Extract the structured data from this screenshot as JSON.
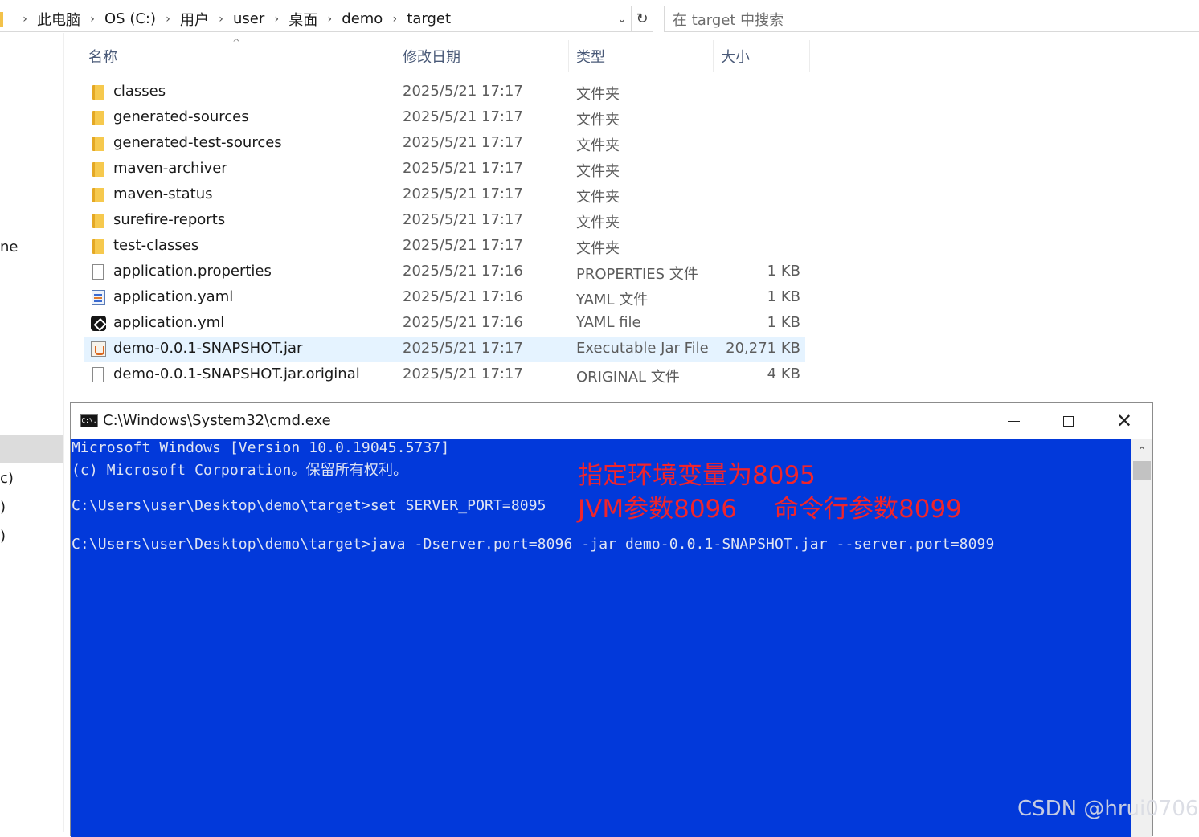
{
  "breadcrumb": [
    "此电脑",
    "OS (C:)",
    "用户",
    "user",
    "桌面",
    "demo",
    "target"
  ],
  "search": {
    "placeholder": "在 target 中搜索"
  },
  "nav_pane": {
    "fragments": [
      "ne",
      "c)",
      ")",
      ")"
    ]
  },
  "columns": {
    "name": "名称",
    "modified": "修改日期",
    "type": "类型",
    "size": "大小"
  },
  "files": [
    {
      "name": "classes",
      "modified": "2025/5/21 17:17",
      "type": "文件夹",
      "size": "",
      "icon": "folder-icon"
    },
    {
      "name": "generated-sources",
      "modified": "2025/5/21 17:17",
      "type": "文件夹",
      "size": "",
      "icon": "folder-icon"
    },
    {
      "name": "generated-test-sources",
      "modified": "2025/5/21 17:17",
      "type": "文件夹",
      "size": "",
      "icon": "folder-icon"
    },
    {
      "name": "maven-archiver",
      "modified": "2025/5/21 17:17",
      "type": "文件夹",
      "size": "",
      "icon": "folder-icon"
    },
    {
      "name": "maven-status",
      "modified": "2025/5/21 17:17",
      "type": "文件夹",
      "size": "",
      "icon": "folder-icon"
    },
    {
      "name": "surefire-reports",
      "modified": "2025/5/21 17:17",
      "type": "文件夹",
      "size": "",
      "icon": "folder-icon"
    },
    {
      "name": "test-classes",
      "modified": "2025/5/21 17:17",
      "type": "文件夹",
      "size": "",
      "icon": "folder-icon"
    },
    {
      "name": "application.properties",
      "modified": "2025/5/21 17:16",
      "type": "PROPERTIES 文件",
      "size": "1 KB",
      "icon": "document-icon"
    },
    {
      "name": "application.yaml",
      "modified": "2025/5/21 17:16",
      "type": "YAML 文件",
      "size": "1 KB",
      "icon": "yaml-file-icon"
    },
    {
      "name": "application.yml",
      "modified": "2025/5/21 17:16",
      "type": "YAML file",
      "size": "1 KB",
      "icon": "yml-app-icon"
    },
    {
      "name": "demo-0.0.1-SNAPSHOT.jar",
      "modified": "2025/5/21 17:17",
      "type": "Executable Jar File",
      "size": "20,271 KB",
      "icon": "jar-file-icon",
      "selected": true
    },
    {
      "name": "demo-0.0.1-SNAPSHOT.jar.original",
      "modified": "2025/5/21 17:17",
      "type": "ORIGINAL 文件",
      "size": "4 KB",
      "icon": "document-icon"
    }
  ],
  "cmd": {
    "title": "C:\\Windows\\System32\\cmd.exe",
    "icon_text": "C:\\.",
    "lines": [
      "Microsoft Windows [Version 10.0.19045.5737]",
      "(c) Microsoft Corporation。保留所有权利。",
      "",
      "C:\\Users\\user\\Desktop\\demo\\target>set SERVER_PORT=8095",
      "",
      "C:\\Users\\user\\Desktop\\demo\\target>java -Dserver.port=8096 -jar demo-0.0.1-SNAPSHOT.jar --server.port=8099"
    ],
    "annotations": {
      "env": "指定环境变量为8095",
      "jvm": "JVM参数8096",
      "cli": "命令行参数8099"
    },
    "annotation_color": "#f0242c",
    "background_color": "#0239da"
  },
  "watermark": "CSDN @hrui0706"
}
